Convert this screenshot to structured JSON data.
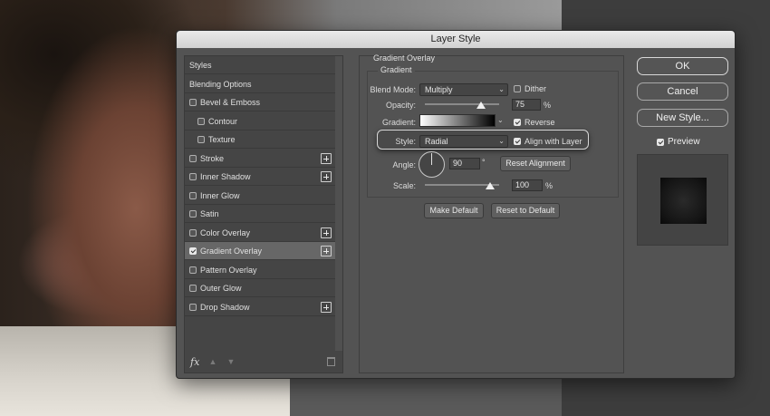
{
  "dialog": {
    "title": "Layer Style"
  },
  "styles_list": {
    "items": [
      {
        "label": "Styles",
        "checkbox": false,
        "checked": false,
        "indent": false,
        "plus": false,
        "active": false
      },
      {
        "label": "Blending Options",
        "checkbox": false,
        "checked": false,
        "indent": false,
        "plus": false,
        "active": false
      },
      {
        "label": "Bevel & Emboss",
        "checkbox": true,
        "checked": false,
        "indent": false,
        "plus": false,
        "active": false
      },
      {
        "label": "Contour",
        "checkbox": true,
        "checked": false,
        "indent": true,
        "plus": false,
        "active": false
      },
      {
        "label": "Texture",
        "checkbox": true,
        "checked": false,
        "indent": true,
        "plus": false,
        "active": false
      },
      {
        "label": "Stroke",
        "checkbox": true,
        "checked": false,
        "indent": false,
        "plus": true,
        "active": false
      },
      {
        "label": "Inner Shadow",
        "checkbox": true,
        "checked": false,
        "indent": false,
        "plus": true,
        "active": false
      },
      {
        "label": "Inner Glow",
        "checkbox": true,
        "checked": false,
        "indent": false,
        "plus": false,
        "active": false
      },
      {
        "label": "Satin",
        "checkbox": true,
        "checked": false,
        "indent": false,
        "plus": false,
        "active": false
      },
      {
        "label": "Color Overlay",
        "checkbox": true,
        "checked": false,
        "indent": false,
        "plus": true,
        "active": false
      },
      {
        "label": "Gradient Overlay",
        "checkbox": true,
        "checked": true,
        "indent": false,
        "plus": true,
        "active": true
      },
      {
        "label": "Pattern Overlay",
        "checkbox": true,
        "checked": false,
        "indent": false,
        "plus": false,
        "active": false
      },
      {
        "label": "Outer Glow",
        "checkbox": true,
        "checked": false,
        "indent": false,
        "plus": false,
        "active": false
      },
      {
        "label": "Drop Shadow",
        "checkbox": true,
        "checked": false,
        "indent": false,
        "plus": true,
        "active": false
      }
    ],
    "footer": {
      "fx_label": "fx",
      "up_icon": "arrow-up-icon",
      "down_icon": "arrow-down-icon",
      "trash_icon": "trash-icon"
    }
  },
  "gradient_overlay": {
    "section_title": "Gradient Overlay",
    "group_title": "Gradient",
    "blend_mode": {
      "label": "Blend Mode:",
      "value": "Multiply"
    },
    "dither": {
      "label": "Dither",
      "checked": false
    },
    "opacity": {
      "label": "Opacity:",
      "value": "75",
      "unit": "%",
      "fraction": 0.75
    },
    "gradient": {
      "label": "Gradient:"
    },
    "reverse": {
      "label": "Reverse",
      "checked": true
    },
    "style": {
      "label": "Style:",
      "value": "Radial"
    },
    "align_with_layer": {
      "label": "Align with Layer",
      "checked": true
    },
    "angle": {
      "label": "Angle:",
      "value": "90",
      "unit": "°"
    },
    "reset_alignment": "Reset Alignment",
    "scale": {
      "label": "Scale:",
      "value": "100",
      "unit": "%",
      "fraction": 0.33
    },
    "make_default": "Make Default",
    "reset_to_default": "Reset to Default"
  },
  "right_panel": {
    "ok": "OK",
    "cancel": "Cancel",
    "new_style": "New Style...",
    "preview": {
      "label": "Preview",
      "checked": true
    }
  }
}
